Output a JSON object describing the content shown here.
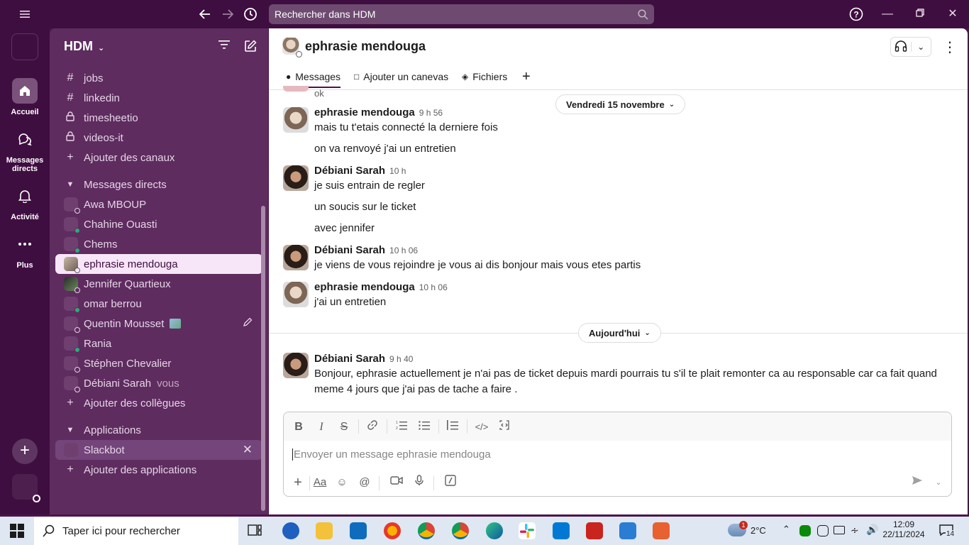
{
  "search": {
    "placeholder": "Rechercher dans HDM"
  },
  "rail": {
    "home_label": "Accueil",
    "dms_label_line1": "Messages",
    "dms_label_line2": "directs",
    "activity_label": "Activité",
    "more_label": "Plus"
  },
  "workspace": {
    "name": "HDM"
  },
  "sidebar": {
    "channels": [
      {
        "icon": "#",
        "label": "jobs"
      },
      {
        "icon": "#",
        "label": "linkedin"
      },
      {
        "icon": "lock",
        "label": "timesheetio"
      },
      {
        "icon": "lock",
        "label": "videos-it"
      }
    ],
    "add_channels": "Ajouter des canaux",
    "dm_section": "Messages directs",
    "dms": [
      {
        "label": "Awa MBOUP",
        "status": "away"
      },
      {
        "label": "Chahine Ouasti",
        "status": "online"
      },
      {
        "label": "Chems",
        "status": "online"
      },
      {
        "label": "ephrasie mendouga",
        "status": "away",
        "selected": true
      },
      {
        "label": "Jennifer Quartieux",
        "status": "away"
      },
      {
        "label": "omar berrou",
        "status": "online"
      },
      {
        "label": "Quentin Mousset",
        "status": "away"
      },
      {
        "label": "Rania",
        "status": "online"
      },
      {
        "label": "Stéphen Chevalier",
        "status": "away"
      },
      {
        "label": "Débiani Sarah",
        "status": "away",
        "suffix": "vous"
      }
    ],
    "add_colleagues": "Ajouter des collègues",
    "apps_section": "Applications",
    "apps": [
      {
        "label": "Slackbot"
      }
    ],
    "add_apps": "Ajouter des applications"
  },
  "channel": {
    "title": "ephrasie mendouga",
    "tabs": [
      {
        "label": "Messages",
        "active": true
      },
      {
        "label": "Ajouter un canevas"
      },
      {
        "label": "Fichiers"
      }
    ]
  },
  "messages": {
    "partial_top": "ok",
    "day1": "Vendredi 15 novembre",
    "day2": "Aujourd'hui",
    "items": [
      {
        "author": "ephrasie mendouga",
        "time": "9 h 56",
        "lines": [
          "mais tu t'etais connecté la derniere fois",
          "on va renvoyé j'ai un entretien"
        ]
      },
      {
        "author": "Débiani Sarah",
        "time": "10 h",
        "lines": [
          "je suis entrain de regler",
          "un soucis sur le ticket",
          "avec jennifer"
        ]
      },
      {
        "author": "Débiani Sarah",
        "time": "10 h 06",
        "lines": [
          "je viens de vous rejoindre je vous ai dis bonjour mais vous etes partis"
        ]
      },
      {
        "author": "ephrasie mendouga",
        "time": "10 h 06",
        "lines": [
          "j'ai un entretien"
        ]
      },
      {
        "author": "Débiani Sarah",
        "time": "9 h 40",
        "lines": [
          "Bonjour, ephrasie actuellement je n'ai pas de ticket depuis mardi pourrais tu s'il te plait remonter ca au responsable car ca fait quand",
          "meme 4 jours que j'ai pas de tache a faire ."
        ]
      }
    ]
  },
  "composer": {
    "placeholder": "Envoyer un message ephrasie mendouga"
  },
  "taskbar": {
    "search": "Taper ici pour rechercher",
    "temperature": "2°C",
    "time": "12:09",
    "date": "22/11/2024",
    "notifications": "14",
    "weather_badge": "1"
  }
}
